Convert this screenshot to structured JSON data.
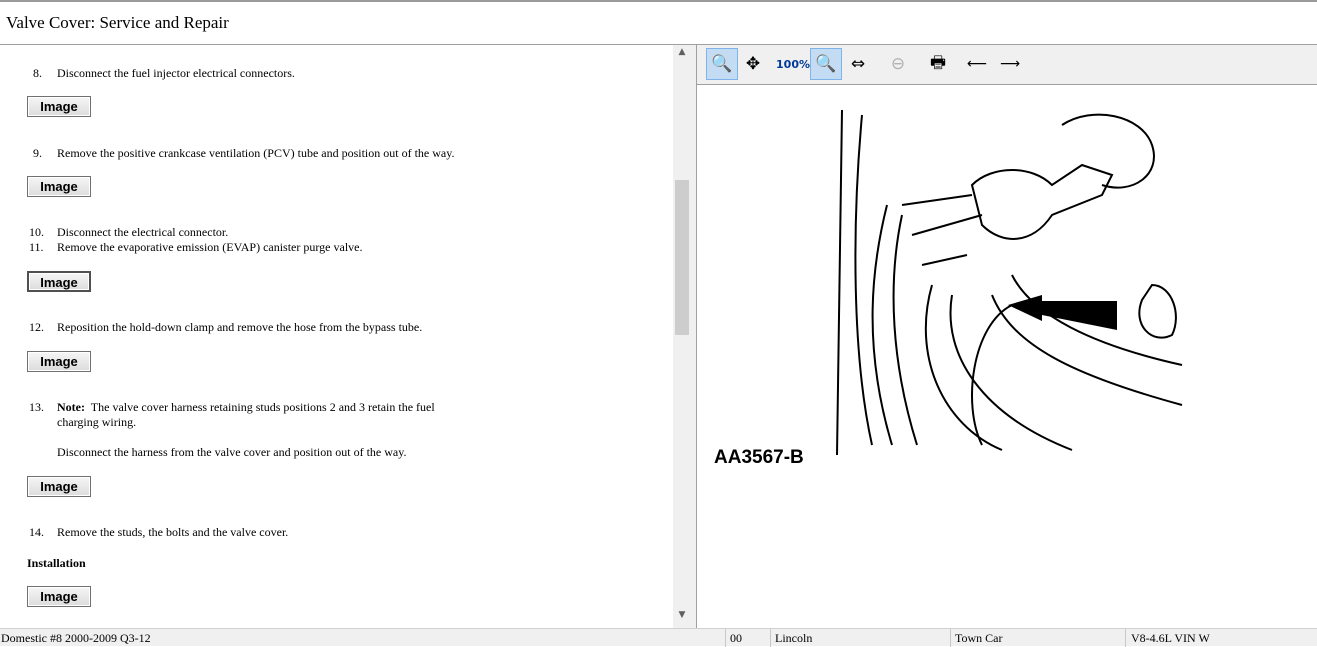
{
  "title": "Valve Cover:  Service and Repair",
  "image_button_label": "Image",
  "steps": [
    {
      "num": "8.",
      "text": "Disconnect the fuel injector electrical connectors."
    },
    {
      "num": "9.",
      "text": "Remove the positive crankcase ventilation (PCV) tube and position out of the way."
    },
    {
      "num": "10.",
      "text": "Disconnect the electrical connector."
    },
    {
      "num": "11.",
      "text": "Remove the evaporative emission (EVAP) canister purge valve."
    },
    {
      "num": "12.",
      "text": "Reposition the hold-down clamp and remove the hose from the bypass tube."
    },
    {
      "num": "13.",
      "note_label": "Note:",
      "text": "The valve cover harness retaining studs positions 2 and 3 retain the fuel",
      "text2": "charging wiring.",
      "text3": "Disconnect the harness from the valve cover and position out of the way."
    },
    {
      "num": "14.",
      "text": "Remove the studs, the bolts and the valve cover."
    }
  ],
  "installation_heading": "Installation",
  "toolbar": [
    "zoom-in",
    "pan",
    "zoom-100",
    "zoom-fit",
    "zoom-width",
    "zoom-out",
    "print",
    "previous-image",
    "next-image"
  ],
  "diagram_label": "AA3567-B",
  "status": {
    "database": "Domestic #8 2000-2009 Q3-12",
    "code": "00",
    "make": "Lincoln",
    "model": "Town Car",
    "engine": "V8-4.6L VIN W"
  }
}
